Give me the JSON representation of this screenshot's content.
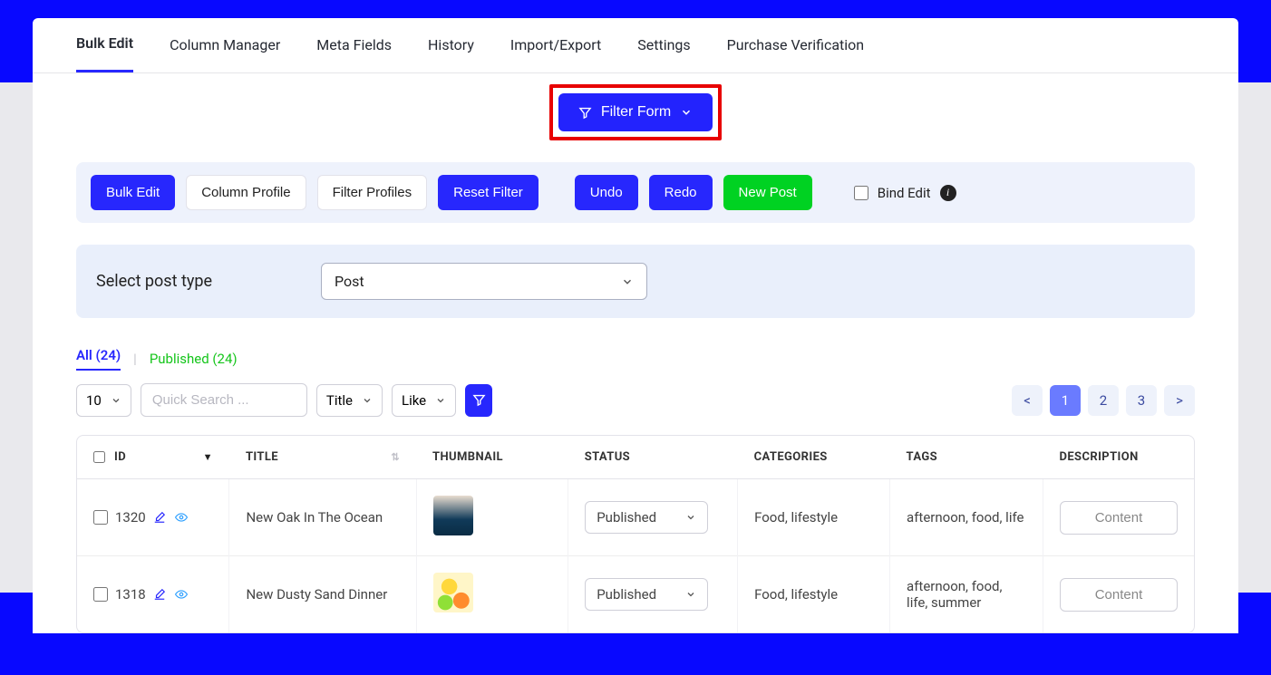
{
  "tabs": {
    "items": [
      {
        "label": "Bulk Edit",
        "active": true
      },
      {
        "label": "Column Manager"
      },
      {
        "label": "Meta Fields"
      },
      {
        "label": "History"
      },
      {
        "label": "Import/Export"
      },
      {
        "label": "Settings"
      },
      {
        "label": "Purchase Verification"
      }
    ]
  },
  "filter_form": {
    "label": "Filter Form"
  },
  "toolbar": {
    "bulk_edit": "Bulk Edit",
    "column_profile": "Column Profile",
    "filter_profiles": "Filter Profiles",
    "reset_filter": "Reset Filter",
    "undo": "Undo",
    "redo": "Redo",
    "new_post": "New Post",
    "bind_edit": "Bind Edit"
  },
  "post_type": {
    "label": "Select post type",
    "value": "Post"
  },
  "status_tabs": {
    "all": "All (24)",
    "published": "Published (24)"
  },
  "controls": {
    "page_size": "10",
    "search_placeholder": "Quick Search ...",
    "search_field": "Title",
    "operator": "Like"
  },
  "pagination": {
    "prev": "<",
    "pages": [
      "1",
      "2",
      "3"
    ],
    "next": ">",
    "active": "1"
  },
  "table": {
    "headers": {
      "id": "ID",
      "title": "TITLE",
      "thumbnail": "THUMBNAIL",
      "status": "STATUS",
      "categories": "CATEGORIES",
      "tags": "TAGS",
      "description": "DESCRIPTION"
    },
    "rows": [
      {
        "id": "1320",
        "title": "New Oak In The Ocean",
        "status": "Published",
        "categories": "Food, lifestyle",
        "tags": "afternoon, food, life",
        "desc_btn": "Content"
      },
      {
        "id": "1318",
        "title": "New Dusty Sand Dinner",
        "status": "Published",
        "categories": "Food, lifestyle",
        "tags": "afternoon, food, life, summer",
        "desc_btn": "Content"
      }
    ]
  }
}
